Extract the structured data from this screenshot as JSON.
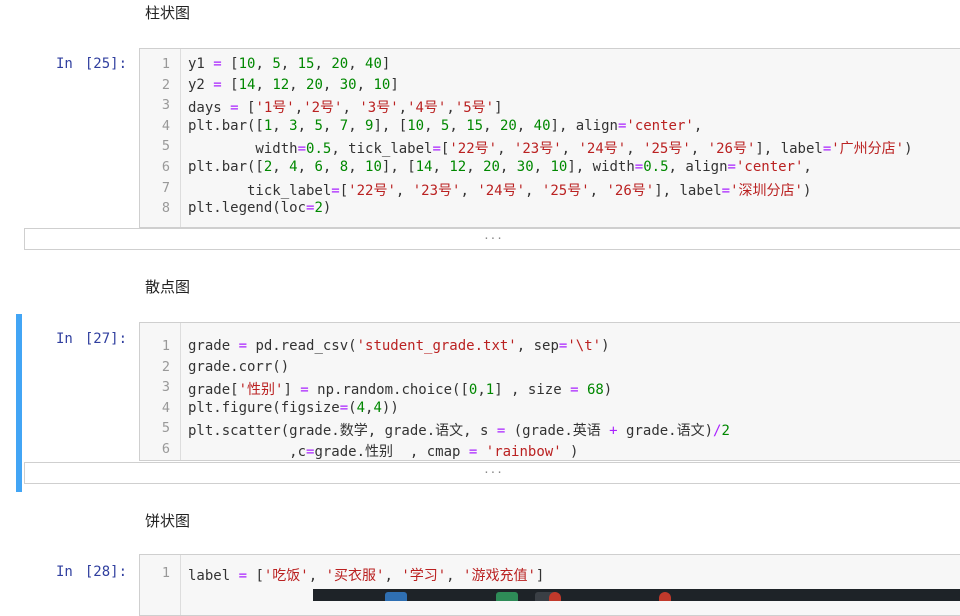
{
  "sections": [
    {
      "heading": "柱状图",
      "prompt_label": "In",
      "prompt_num": "[25]:",
      "line_numbers": [
        "1",
        "2",
        "3",
        "4",
        "5",
        "6",
        "7",
        "8"
      ],
      "code": [
        "y1 = [10, 5, 15, 20, 40]",
        "y2 = [14, 12, 20, 30, 10]",
        "days = ['1号','2号', '3号','4号','5号']",
        "plt.bar([1, 3, 5, 7, 9], [10, 5, 15, 20, 40], align='center',",
        "        width=0.5, tick_label=['22号', '23号', '24号', '25号', '26号'], label='广州分店')",
        "plt.bar([2, 4, 6, 8, 10], [14, 12, 20, 30, 10], width=0.5, align='center',",
        "       tick_label=['22号', '23号', '24号', '25号', '26号'], label='深圳分店')",
        "plt.legend(loc=2)"
      ],
      "output_collapsed": "..."
    },
    {
      "heading": "散点图",
      "prompt_label": "In",
      "prompt_num": "[27]:",
      "line_numbers": [
        "1",
        "2",
        "3",
        "4",
        "5",
        "6"
      ],
      "code": [
        "grade = pd.read_csv('student_grade.txt', sep='\\t')",
        "grade.corr()",
        "grade['性别'] = np.random.choice([0,1] , size = 68)",
        "plt.figure(figsize=(4,4))",
        "plt.scatter(grade.数学, grade.语文, s = (grade.英语 + grade.语文)/2",
        "            ,c=grade.性别  , cmap = 'rainbow' )"
      ],
      "output_collapsed": "..."
    },
    {
      "heading": "饼状图",
      "prompt_label": "In",
      "prompt_num": "[28]:",
      "line_numbers": [
        "1"
      ],
      "code": [
        "label = ['吃饭', '买衣服', '学习', '游戏充值']"
      ]
    }
  ],
  "taskbar": {
    "icons": [
      "start-icon",
      "file-explorer-icon",
      "spreadsheet-icon",
      "browser-icon",
      "media-icon"
    ]
  },
  "colors": {
    "selected_cell_bar": "#42a5f5",
    "prompt": "#303f9f",
    "string": "#ba2121",
    "number": "#008800",
    "operator": "#aa22ff"
  }
}
